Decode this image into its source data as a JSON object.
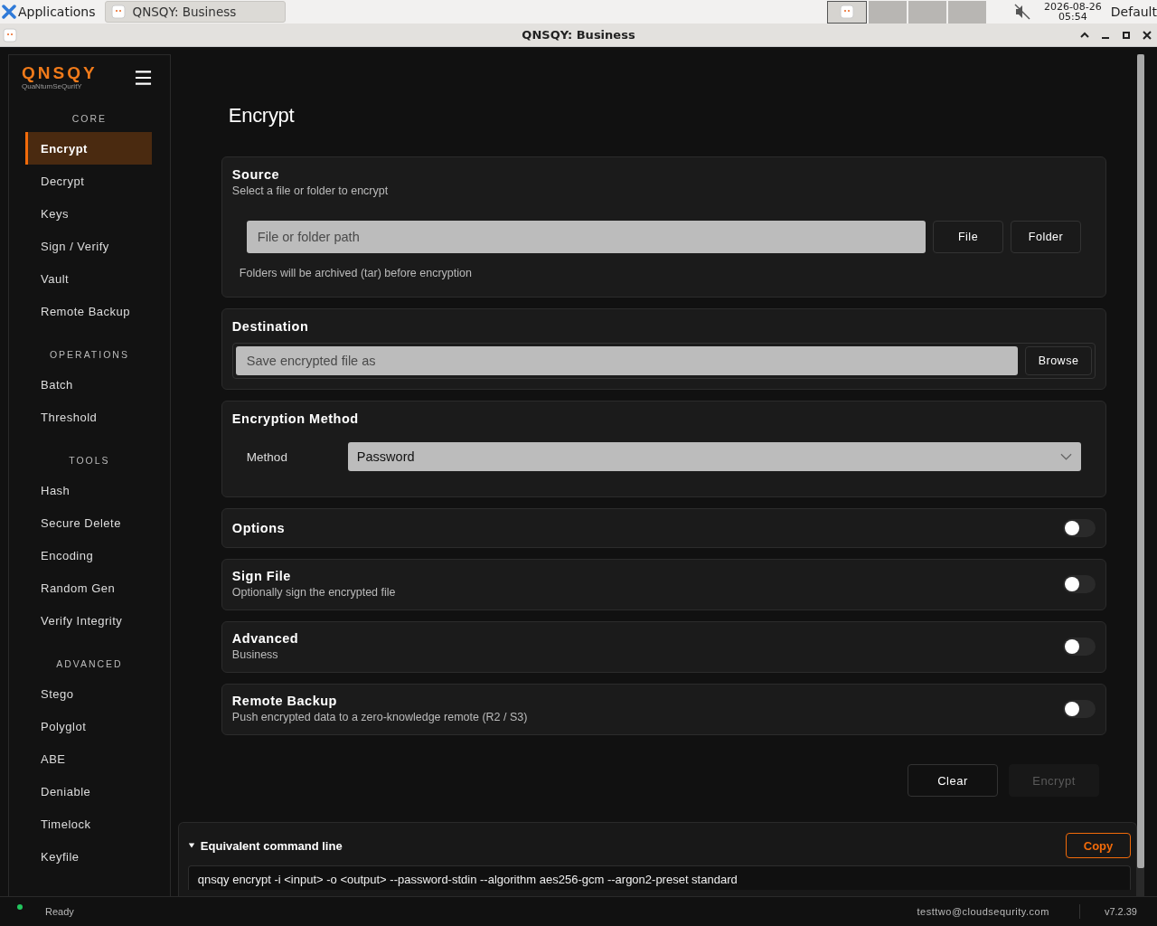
{
  "taskbar": {
    "launcher": "Applications",
    "tasks": [
      {
        "label": "QNSQY: Business",
        "selected": true
      }
    ],
    "workspaces": [
      {
        "selected": true
      },
      {
        "selected": false
      },
      {
        "selected": false
      },
      {
        "selected": false
      }
    ],
    "muted": true,
    "clock_date": "2026-08-26",
    "clock_time": "05:54",
    "layout": "Default"
  },
  "window": {
    "title": "QNSQY: Business"
  },
  "sidebar": {
    "logo": "QNSQY",
    "tagline": "QuaNtumSeQuritY",
    "sections": [
      {
        "heading": "CORE",
        "items": [
          {
            "label": "Encrypt",
            "selected": true
          },
          {
            "label": "Decrypt",
            "selected": false
          },
          {
            "label": "Keys",
            "selected": false
          },
          {
            "label": "Sign / Verify",
            "selected": false
          },
          {
            "label": "Vault",
            "selected": false
          },
          {
            "label": "Remote Backup",
            "selected": false
          }
        ]
      },
      {
        "heading": "OPERATIONS",
        "items": [
          {
            "label": "Batch",
            "selected": false
          },
          {
            "label": "Threshold",
            "selected": false
          }
        ]
      },
      {
        "heading": "TOOLS",
        "items": [
          {
            "label": "Hash",
            "selected": false
          },
          {
            "label": "Secure Delete",
            "selected": false
          },
          {
            "label": "Encoding",
            "selected": false
          },
          {
            "label": "Random Gen",
            "selected": false
          },
          {
            "label": "Verify Integrity",
            "selected": false
          }
        ]
      },
      {
        "heading": "ADVANCED",
        "items": [
          {
            "label": "Stego",
            "selected": false
          },
          {
            "label": "Polyglot",
            "selected": false
          },
          {
            "label": "ABE",
            "selected": false
          },
          {
            "label": "Deniable",
            "selected": false
          },
          {
            "label": "Timelock",
            "selected": false
          },
          {
            "label": "Keyfile",
            "selected": false
          }
        ]
      }
    ]
  },
  "page": {
    "title": "Encrypt",
    "source": {
      "title": "Source",
      "subtitle": "Select a file or folder to encrypt",
      "placeholder": "File or folder path",
      "buttons": [
        "File",
        "Folder"
      ],
      "hint": "Folders will be archived (tar) before encryption"
    },
    "destination": {
      "title": "Destination",
      "placeholder": "Save encrypted file as",
      "button": "Browse"
    },
    "method": {
      "title": "Encryption Method",
      "label": "Method",
      "value": "Password"
    },
    "toggles": [
      {
        "title": "Options",
        "on": false
      },
      {
        "title": "Sign File",
        "subtitle": "Optionally sign the encrypted file",
        "on": false
      },
      {
        "title": "Advanced",
        "subtitle": "Business",
        "on": false
      },
      {
        "title": "Remote Backup",
        "subtitle": "Push encrypted data to a zero-knowledge remote (R2 / S3)",
        "on": false
      }
    ],
    "actions": [
      {
        "label": "Clear",
        "disabled": false
      },
      {
        "label": "Encrypt",
        "disabled": true
      }
    ]
  },
  "command": {
    "title": "Equivalent command line",
    "expanded": true,
    "copy": "Copy",
    "text": "qnsqy encrypt -i <input> -o <output> --password-stdin --algorithm aes256-gcm --argon2-preset standard"
  },
  "status_bar": {
    "connected": true,
    "status": "Ready",
    "user": "testtwo@cloudsequrity.com",
    "version": "v7.2.39"
  }
}
